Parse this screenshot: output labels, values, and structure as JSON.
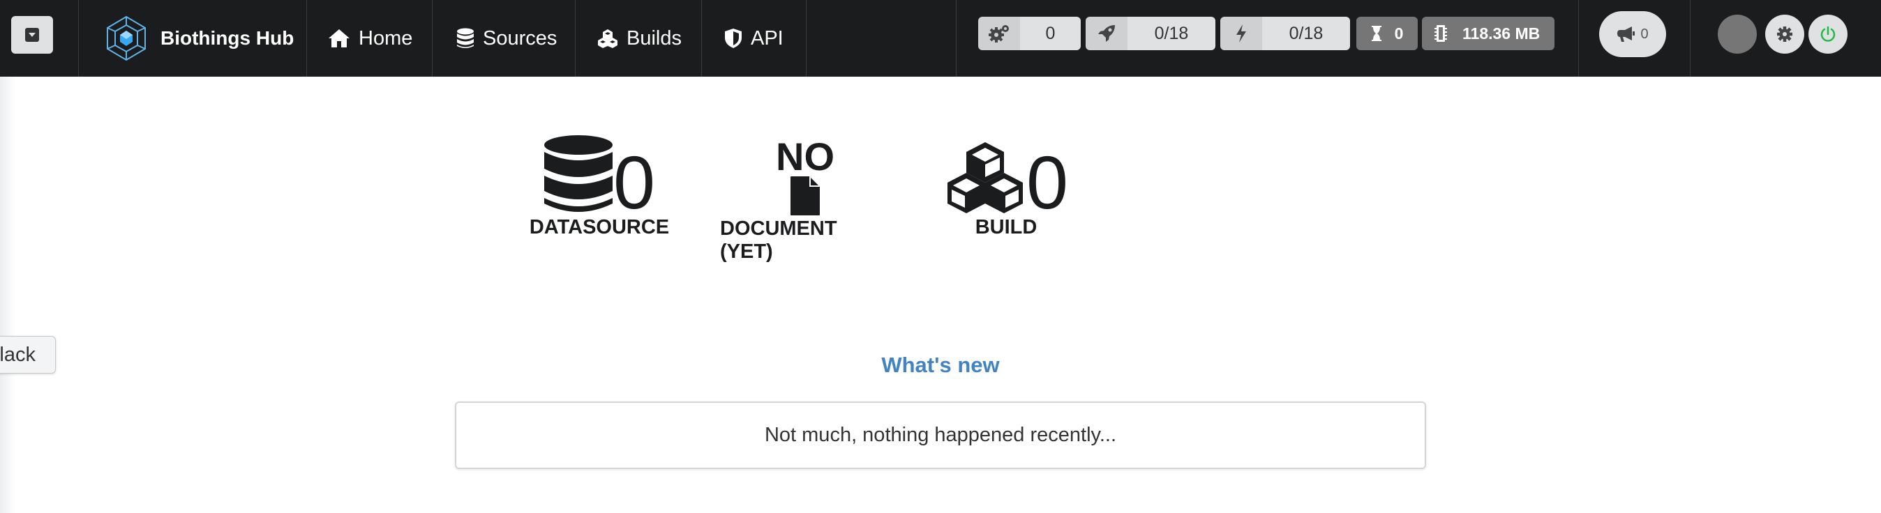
{
  "app": {
    "name": "Biothings Hub"
  },
  "nav": [
    {
      "label": "Home",
      "icon": "home-icon"
    },
    {
      "label": "Sources",
      "icon": "database-icon"
    },
    {
      "label": "Builds",
      "icon": "cubes-icon"
    },
    {
      "label": "API",
      "icon": "shield-icon"
    }
  ],
  "status": {
    "processes": {
      "icon": "cogs-icon",
      "value": "0"
    },
    "running": {
      "icon": "rocket-icon",
      "value": "0/18"
    },
    "threads": {
      "icon": "bolt-icon",
      "value": "0/18"
    },
    "pending": {
      "icon": "hourglass-icon",
      "value": "0"
    },
    "memory": {
      "icon": "memory-icon",
      "value": "118.36 MB"
    },
    "notifications": {
      "icon": "bullhorn-icon",
      "value": "0"
    }
  },
  "stats": {
    "datasource": {
      "count": "0",
      "label": "DATASOURCE"
    },
    "documents": {
      "count": "NO",
      "label": "DOCUMENT (YET)"
    },
    "build": {
      "count": "0",
      "label": "BUILD"
    }
  },
  "slack": {
    "label": "lack"
  },
  "news": {
    "title": "What's new",
    "empty_message": "Not much, nothing happened recently..."
  },
  "colors": {
    "topbar": "#1b1c1d",
    "accent": "#4183c4",
    "power": "#21ba45"
  }
}
